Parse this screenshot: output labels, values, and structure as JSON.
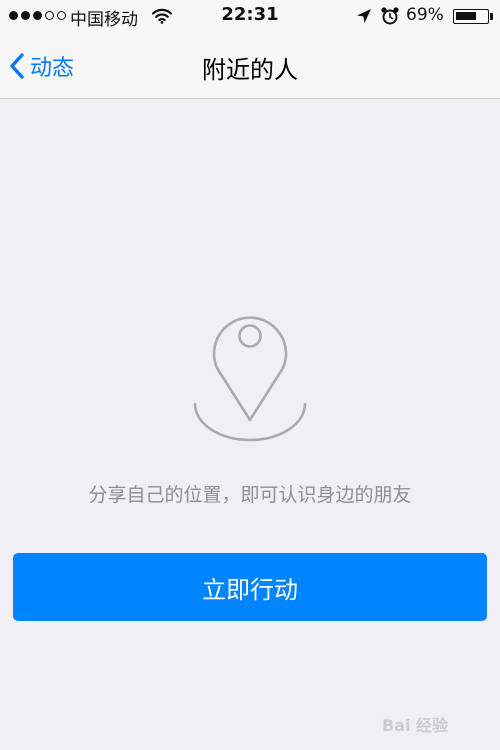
{
  "status_bar": {
    "signal_bars_on": 3,
    "signal_bars_total": 5,
    "carrier": "中国移动",
    "time": "22:31",
    "battery_percent": "69%",
    "battery_level": 0.69,
    "icons": [
      "wifi-icon",
      "location-arrow-icon",
      "alarm-icon",
      "battery-icon"
    ]
  },
  "nav": {
    "back_label": "动态",
    "title": "附近的人"
  },
  "empty_state": {
    "icon": "map-pin-icon",
    "hint": "分享自己的位置，即可认识身边的朋友"
  },
  "action": {
    "button_label": "立即行动"
  },
  "watermark": {
    "text": "Bai 经验"
  },
  "colors": {
    "accent": "#0079ff",
    "button": "#0084ff",
    "background": "#efeff4",
    "hint_text": "#8e8e93"
  }
}
